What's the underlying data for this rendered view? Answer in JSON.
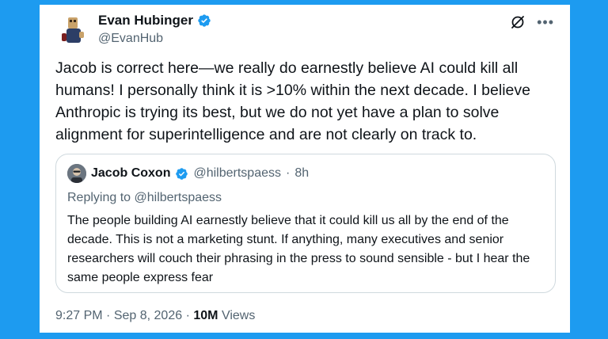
{
  "author": {
    "display_name": "Evan Hubinger",
    "handle": "@EvanHub",
    "verified_icon": "verified-badge-icon"
  },
  "header_actions": {
    "grok_icon": "grok-icon",
    "more_icon": "more-icon"
  },
  "tweet": {
    "text": "Jacob is correct here—we really do earnestly believe AI could kill all humans! I personally think it is >10% within the next decade. I believe Anthropic is trying its best, but we do not yet have a plan to solve alignment for superintelligence and are not clearly on track to."
  },
  "quoted": {
    "display_name": "Jacob Coxon",
    "handle": "@hilbertspaess",
    "separator": "·",
    "time": "8h",
    "replying_prefix": "Replying to",
    "replying_handle": "@hilbertspaess",
    "text": "The people building AI earnestly believe that it could kill us all by the end of the decade. This is not a marketing stunt. If anything, many executives and senior researchers will couch their phrasing in the press to sound sensible - but I hear the same people express fear"
  },
  "meta": {
    "time": "9:27 PM",
    "separator1": "·",
    "date": "Sep 8, 2026",
    "separator2": "·",
    "views_count": "10M",
    "views_label": "Views"
  },
  "colors": {
    "background": "#1d9bf0",
    "verified": "#1d9bf0",
    "secondary_text": "#536471",
    "primary_text": "#0f1419",
    "border": "#cfd9de"
  }
}
